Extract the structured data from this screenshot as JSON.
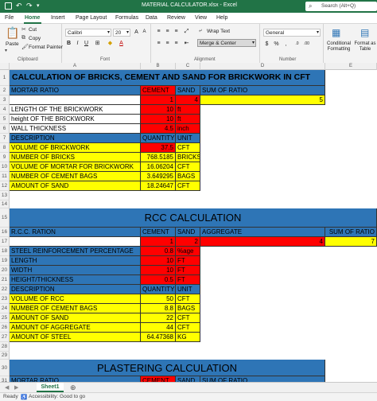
{
  "window": {
    "title": "MATERIAL CALCULATOR.xlsx  -  Excel",
    "search_placeholder": "Search (Alt+Q)"
  },
  "menu": {
    "tabs": [
      "File",
      "Home",
      "Insert",
      "Page Layout",
      "Formulas",
      "Data",
      "Review",
      "View",
      "Help"
    ],
    "active": "Home"
  },
  "ribbon": {
    "clipboard": {
      "paste": "Paste",
      "cut": "Cut",
      "copy": "Copy",
      "format_painter": "Format Painter",
      "label": "Clipboard"
    },
    "font": {
      "name": "Calibri",
      "size": "20",
      "bold": "B",
      "italic": "I",
      "underline": "U",
      "label": "Font"
    },
    "alignment": {
      "wrap": "Wrap Text",
      "merge": "Merge & Center",
      "label": "Alignment"
    },
    "number": {
      "format": "General",
      "label": "Number"
    },
    "styles": {
      "conditional": "Conditional Formatting",
      "table": "Format as Table"
    }
  },
  "columns": [
    "A",
    "B",
    "C",
    "D",
    "E"
  ],
  "rows": {
    "r1": "CALCULATION OF BRICKS, CEMENT AND SAND FOR BRICKWORK IN CFT",
    "r2": [
      "MORTAR RATIO",
      "CEMENT",
      "SAND",
      "SUM OF RATIO"
    ],
    "r3": [
      "1",
      "4",
      "5"
    ],
    "r4": [
      "LENGTH OF THE BRICKWORK",
      "10",
      "ft"
    ],
    "r5": [
      "height OF THE BRICKWORK",
      "10",
      "ft"
    ],
    "r6": [
      "WALL THICKNESS",
      "4.5",
      "inch"
    ],
    "r7": [
      "DESCRIPTION",
      "QUANTITY",
      "UNIT"
    ],
    "r8": [
      "VOLUME OF BRICKWORK",
      "37.5",
      "CFT"
    ],
    "r9": [
      "NUMBER OF BRICKS",
      "768.5185",
      "BRICKS"
    ],
    "r10": [
      "VOLUME OF MORTAR FOR BRICKWORK",
      "16.06204",
      "CFT"
    ],
    "r11": [
      "NUMBER OF CEMENT BAGS",
      "3.649295",
      "BAGS"
    ],
    "r12": [
      "AMOUNT OF  SAND",
      "18.24647",
      "CFT"
    ],
    "r15": "RCC CALCULATION",
    "r16": [
      "R.C.C. RATION",
      "CEMENT",
      "SAND",
      "AGGREGATE",
      "SUM OF RATIO"
    ],
    "r17": [
      "1",
      "2",
      "4",
      "7"
    ],
    "r18": [
      "STEEL REINFORCEMENT PERCENTAGE",
      "0.8",
      "%age"
    ],
    "r19": [
      "LENGTH",
      "10",
      "FT"
    ],
    "r20": [
      "WIDTH",
      "10",
      "FT"
    ],
    "r21": [
      "HEIGHT/THICKNESS",
      "0.5",
      "FT"
    ],
    "r22": [
      "DESCRIPTION",
      "QUANTITY",
      "UNIT"
    ],
    "r23": [
      "VOLUME OF RCC",
      "50",
      "CFT"
    ],
    "r24": [
      "NUMBER OF CEMENT BAGS",
      "8.8",
      "BAGS"
    ],
    "r25": [
      "AMOUNT OF  SAND",
      "22",
      "CFT"
    ],
    "r26": [
      "AMOUNT OF AGGREGATE",
      "44",
      "CFT"
    ],
    "r27": [
      "AMOUNT OF  STEEL",
      "64.47368",
      "KG"
    ],
    "r30": "PLASTERING CALCULATION",
    "r31": [
      "MORTAR RATIO",
      "CEMENT",
      "SAND",
      "SUM OF RATIO"
    ]
  },
  "sheet_tab": "Sheet1",
  "status": {
    "ready": "Ready",
    "accessibility": "Accessibility: Good to go"
  },
  "colors": {
    "excel_green": "#217346",
    "header_blue": "#2e75b6",
    "red": "#ff0000",
    "yellow": "#ffff00"
  }
}
